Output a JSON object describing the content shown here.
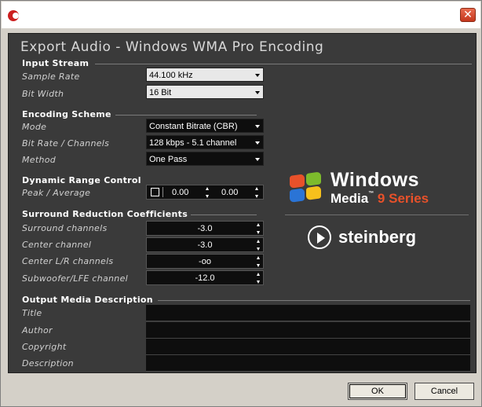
{
  "window": {
    "close_glyph": "✕"
  },
  "panel": {
    "title": "Export Audio - Windows WMA Pro Encoding"
  },
  "input_stream": {
    "title": "Input Stream",
    "sample_rate_label": "Sample Rate",
    "sample_rate_value": "44.100 kHz",
    "bit_width_label": "Bit Width",
    "bit_width_value": "16 Bit"
  },
  "encoding_scheme": {
    "title": "Encoding Scheme",
    "mode_label": "Mode",
    "mode_value": "Constant Bitrate (CBR)",
    "bitrate_label": "Bit Rate / Channels",
    "bitrate_value": "128 kbps - 5.1 channel",
    "method_label": "Method",
    "method_value": "One Pass"
  },
  "dynamic_range": {
    "title": "Dynamic Range Control",
    "peak_label": "Peak  /  Average",
    "peak_value": "0.00",
    "average_value": "0.00",
    "enabled": false
  },
  "surround": {
    "title": "Surround Reduction Coefficients",
    "rows": [
      {
        "label": "Surround channels",
        "value": "-3.0"
      },
      {
        "label": "Center channel",
        "value": "-3.0"
      },
      {
        "label": "Center L/R channels",
        "value": "-oo"
      },
      {
        "label": "Subwoofer/LFE channel",
        "value": "-12.0"
      }
    ]
  },
  "output_media": {
    "title": "Output Media Description",
    "fields": [
      {
        "label": "Title",
        "value": ""
      },
      {
        "label": "Author",
        "value": ""
      },
      {
        "label": "Copyright",
        "value": ""
      },
      {
        "label": "Description",
        "value": ""
      }
    ]
  },
  "logos": {
    "windows": "Windows",
    "media": "Media",
    "tm": "™",
    "series": "9 Series",
    "steinberg": "steinberg"
  },
  "buttons": {
    "ok": "OK",
    "cancel": "Cancel"
  },
  "colors": {
    "panel_bg": "#3a3a3a",
    "field_dark": "#0e0e0e",
    "field_light": "#e8e8e8",
    "accent_series": "#e8512a"
  }
}
